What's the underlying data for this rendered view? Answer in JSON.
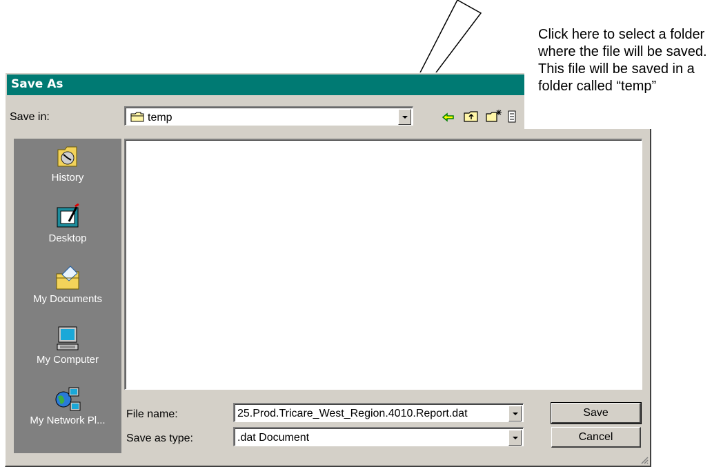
{
  "dialog": {
    "title": "Save As",
    "save_in_label": "Save in:",
    "save_in_value": "temp",
    "file_name_label": "File name:",
    "file_name_value": "25.Prod.Tricare_West_Region.4010.Report.dat",
    "save_as_type_label": "Save as type:",
    "save_as_type_value": ".dat Document",
    "save_button": "Save",
    "cancel_button": "Cancel",
    "places": [
      {
        "label": "History",
        "icon": "history-icon"
      },
      {
        "label": "Desktop",
        "icon": "desktop-icon"
      },
      {
        "label": "My Documents",
        "icon": "my-documents-icon"
      },
      {
        "label": "My Computer",
        "icon": "my-computer-icon"
      },
      {
        "label": "My Network Pl...",
        "icon": "network-places-icon"
      }
    ],
    "toolbar_icons": [
      "back-icon",
      "up-folder-icon",
      "new-folder-icon",
      "view-menu-icon"
    ]
  },
  "annotation": {
    "text": "Click here to select a folder where the file will be saved.  This file will be saved in a folder called “temp”"
  },
  "colors": {
    "title_bar": "#007a73",
    "dialog_face": "#d4d0c8",
    "places_bar": "#808080"
  }
}
